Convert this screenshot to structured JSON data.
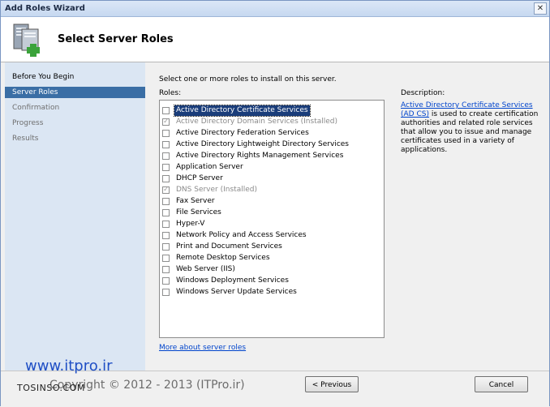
{
  "window": {
    "title": "Add Roles Wizard",
    "close_glyph": "✕"
  },
  "header": {
    "heading": "Select Server Roles",
    "icon": "server-roles-add-icon"
  },
  "nav": {
    "items": [
      {
        "label": "Before You Begin",
        "state": "normal"
      },
      {
        "label": "Server Roles",
        "state": "selected"
      },
      {
        "label": "Confirmation",
        "state": "disabled"
      },
      {
        "label": "Progress",
        "state": "disabled"
      },
      {
        "label": "Results",
        "state": "disabled"
      }
    ]
  },
  "main": {
    "intro": "Select one or more roles to install on this server.",
    "roles_label": "Roles:",
    "roles": [
      {
        "label": "Active Directory Certificate Services",
        "checked": false,
        "disabled": false,
        "selected": true
      },
      {
        "label": "Active Directory Domain Services  (Installed)",
        "checked": true,
        "disabled": true,
        "selected": false
      },
      {
        "label": "Active Directory Federation Services",
        "checked": false,
        "disabled": false,
        "selected": false
      },
      {
        "label": "Active Directory Lightweight Directory Services",
        "checked": false,
        "disabled": false,
        "selected": false
      },
      {
        "label": "Active Directory Rights Management Services",
        "checked": false,
        "disabled": false,
        "selected": false
      },
      {
        "label": "Application Server",
        "checked": false,
        "disabled": false,
        "selected": false
      },
      {
        "label": "DHCP Server",
        "checked": false,
        "disabled": false,
        "selected": false
      },
      {
        "label": "DNS Server  (Installed)",
        "checked": true,
        "disabled": true,
        "selected": false
      },
      {
        "label": "Fax Server",
        "checked": false,
        "disabled": false,
        "selected": false
      },
      {
        "label": "File Services",
        "checked": false,
        "disabled": false,
        "selected": false
      },
      {
        "label": "Hyper-V",
        "checked": false,
        "disabled": false,
        "selected": false
      },
      {
        "label": "Network Policy and Access Services",
        "checked": false,
        "disabled": false,
        "selected": false
      },
      {
        "label": "Print and Document Services",
        "checked": false,
        "disabled": false,
        "selected": false
      },
      {
        "label": "Remote Desktop Services",
        "checked": false,
        "disabled": false,
        "selected": false
      },
      {
        "label": "Web Server (IIS)",
        "checked": false,
        "disabled": false,
        "selected": false
      },
      {
        "label": "Windows Deployment Services",
        "checked": false,
        "disabled": false,
        "selected": false
      },
      {
        "label": "Windows Server Update Services",
        "checked": false,
        "disabled": false,
        "selected": false
      }
    ],
    "more_link": "More about server roles",
    "description_label": "Description:",
    "description_link": "Active Directory Certificate Services (AD CS)",
    "description_text": " is used to create certification authorities and related role services that allow you to issue and manage certificates used in a variety of applications."
  },
  "footer": {
    "previous_label": "< Previous",
    "cancel_label": "Cancel"
  },
  "watermark": {
    "site": "www.itpro.ir",
    "copyright": "Copyright © 2012 - 2013 (ITPro.ir)",
    "corner": "TOSINSO.COM"
  }
}
